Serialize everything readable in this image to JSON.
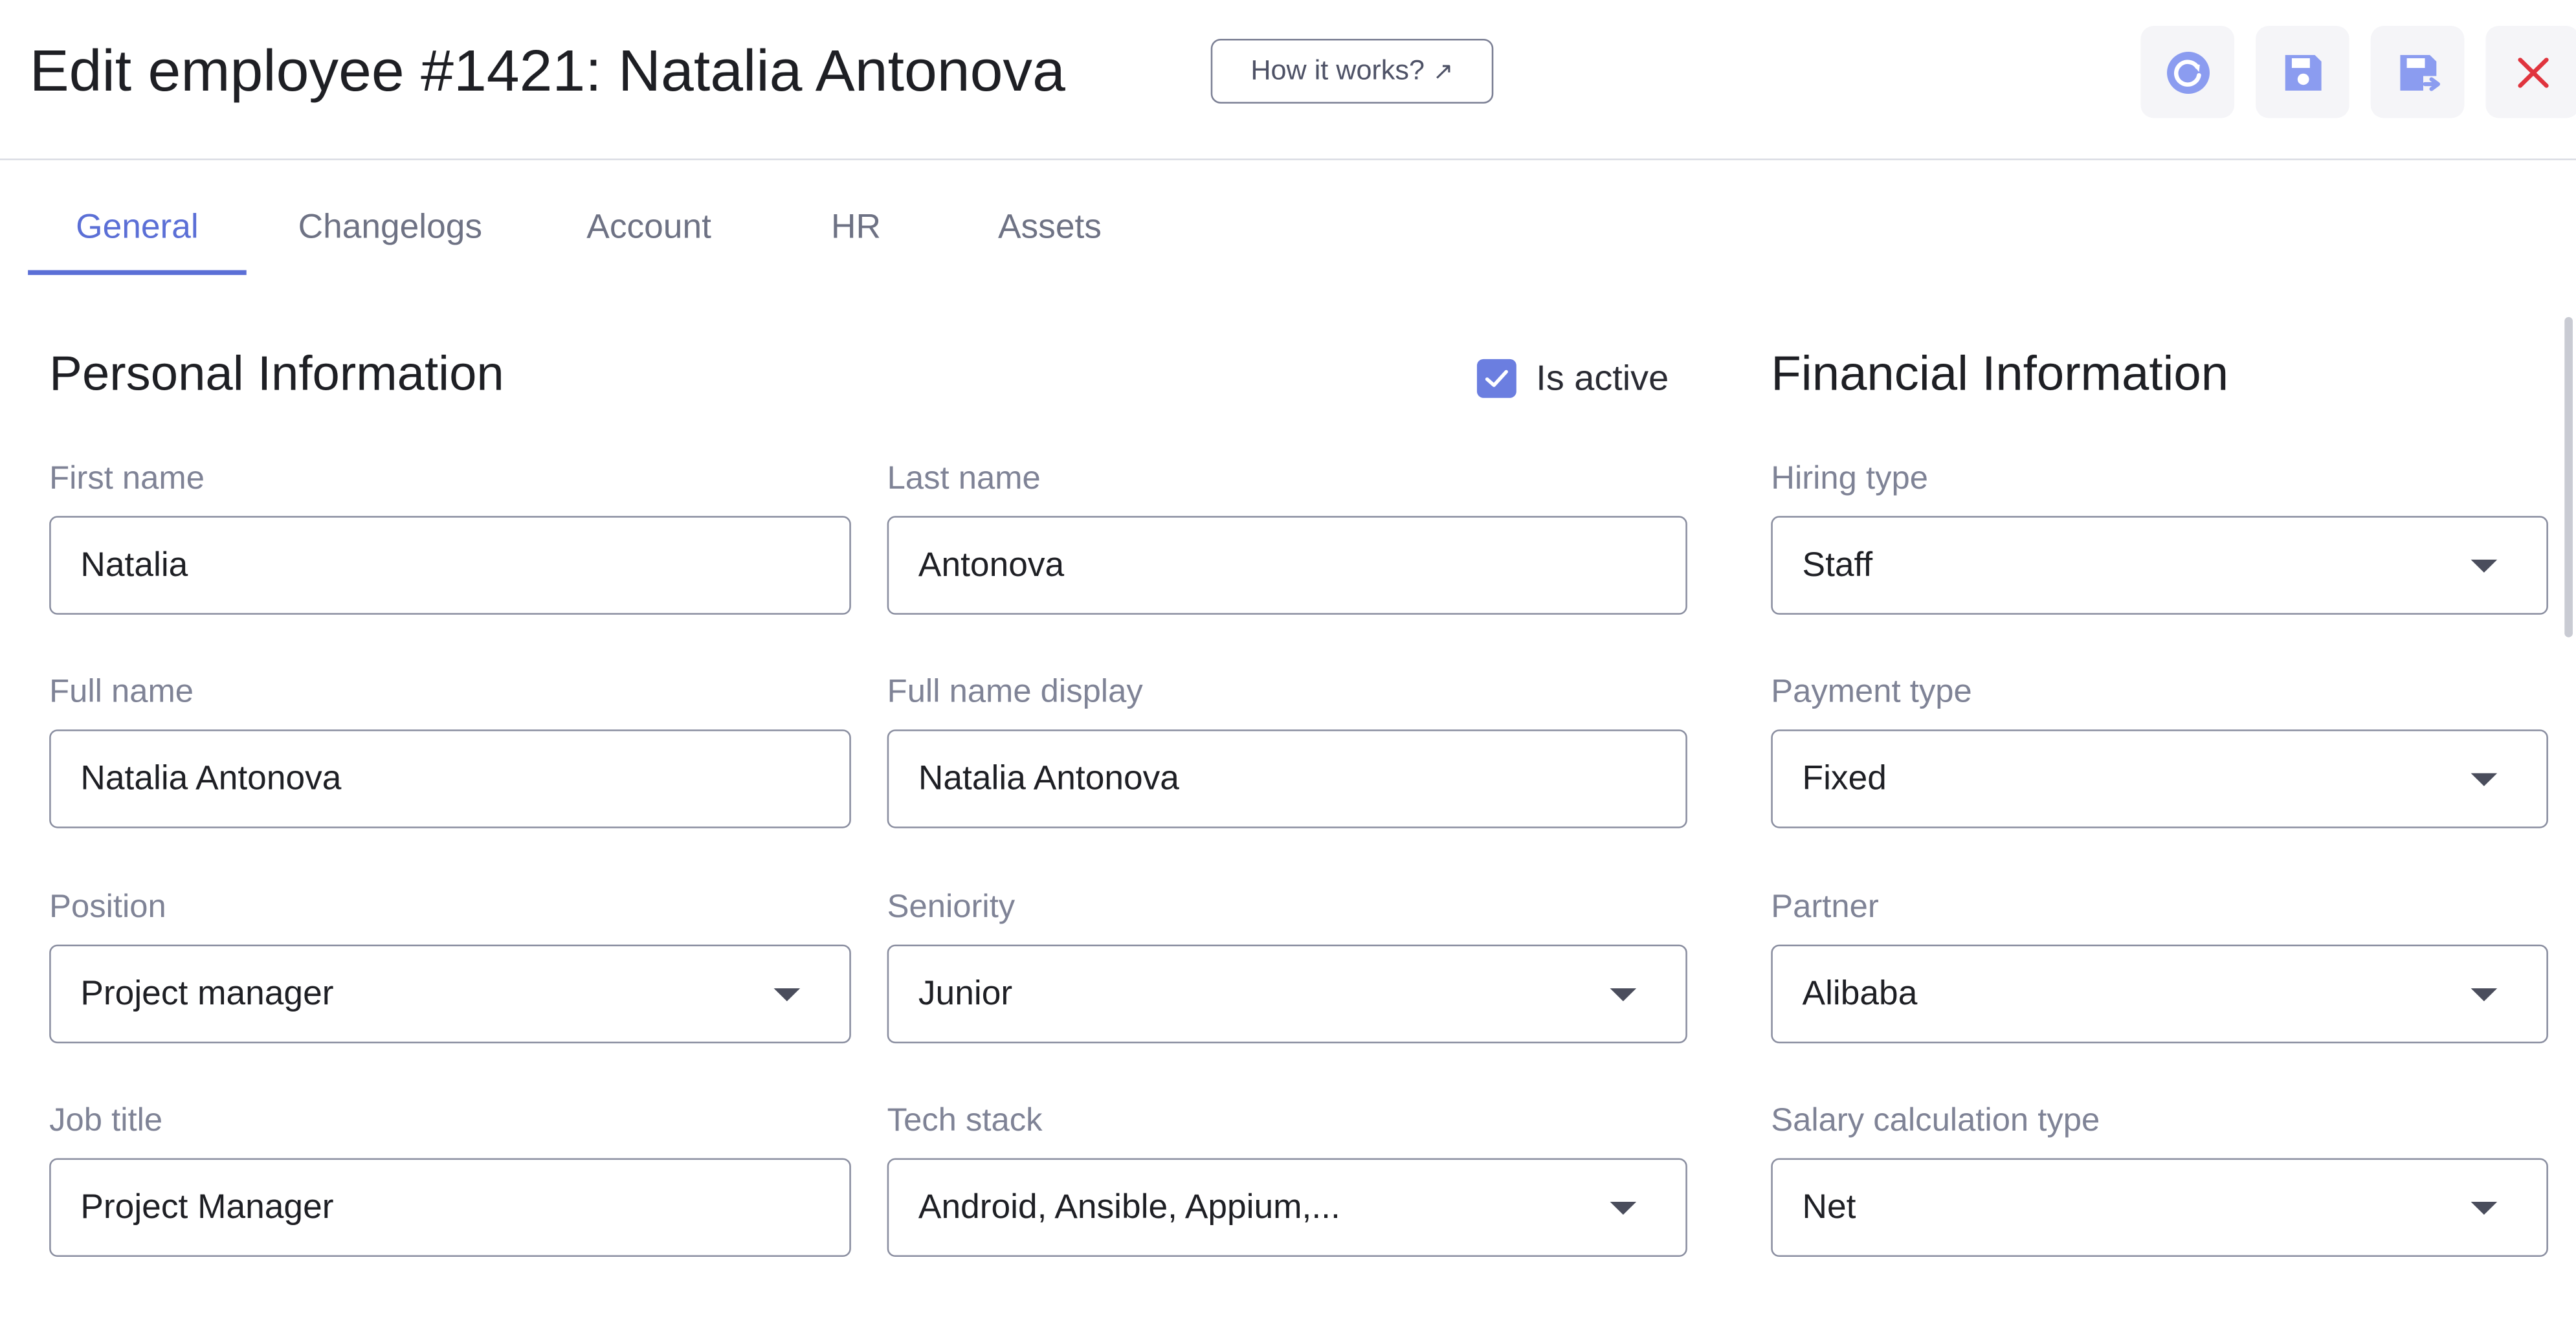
{
  "header": {
    "title": "Edit employee #1421: Natalia Antonova",
    "how_it_works": "How it works?",
    "how_arrow": "↗",
    "colors": {
      "accent": "#5b6fd6",
      "toolbar_icon": "#8b9cf0",
      "close": "#e0343e"
    }
  },
  "toolbar": {
    "refresh_icon": "refresh-icon",
    "save_icon": "save-icon",
    "save_and_close_icon": "save-and-close-icon",
    "close_icon": "close-icon"
  },
  "tabs": [
    {
      "label": "General",
      "active": true
    },
    {
      "label": "Changelogs",
      "active": false
    },
    {
      "label": "Account",
      "active": false
    },
    {
      "label": "HR",
      "active": false
    },
    {
      "label": "Assets",
      "active": false
    }
  ],
  "personal": {
    "title": "Personal Information",
    "is_active_label": "Is active",
    "is_active": true,
    "fields": {
      "first_name": {
        "label": "First name",
        "value": "Natalia"
      },
      "last_name": {
        "label": "Last name",
        "value": "Antonova"
      },
      "full_name": {
        "label": "Full name",
        "value": "Natalia Antonova"
      },
      "full_name_display": {
        "label": "Full name display",
        "value": "Natalia Antonova"
      },
      "position": {
        "label": "Position",
        "value": "Project manager"
      },
      "seniority": {
        "label": "Seniority",
        "value": "Junior"
      },
      "job_title": {
        "label": "Job title",
        "value": "Project Manager"
      },
      "tech_stack": {
        "label": "Tech stack",
        "value": "Android, Ansible, Appium,..."
      }
    }
  },
  "financial": {
    "title": "Financial Information",
    "fields": {
      "hiring_type": {
        "label": "Hiring type",
        "value": "Staff"
      },
      "payment_type": {
        "label": "Payment type",
        "value": "Fixed"
      },
      "partner": {
        "label": "Partner",
        "value": "Alibaba"
      },
      "salary_calc": {
        "label": "Salary calculation type",
        "value": "Net"
      }
    }
  }
}
